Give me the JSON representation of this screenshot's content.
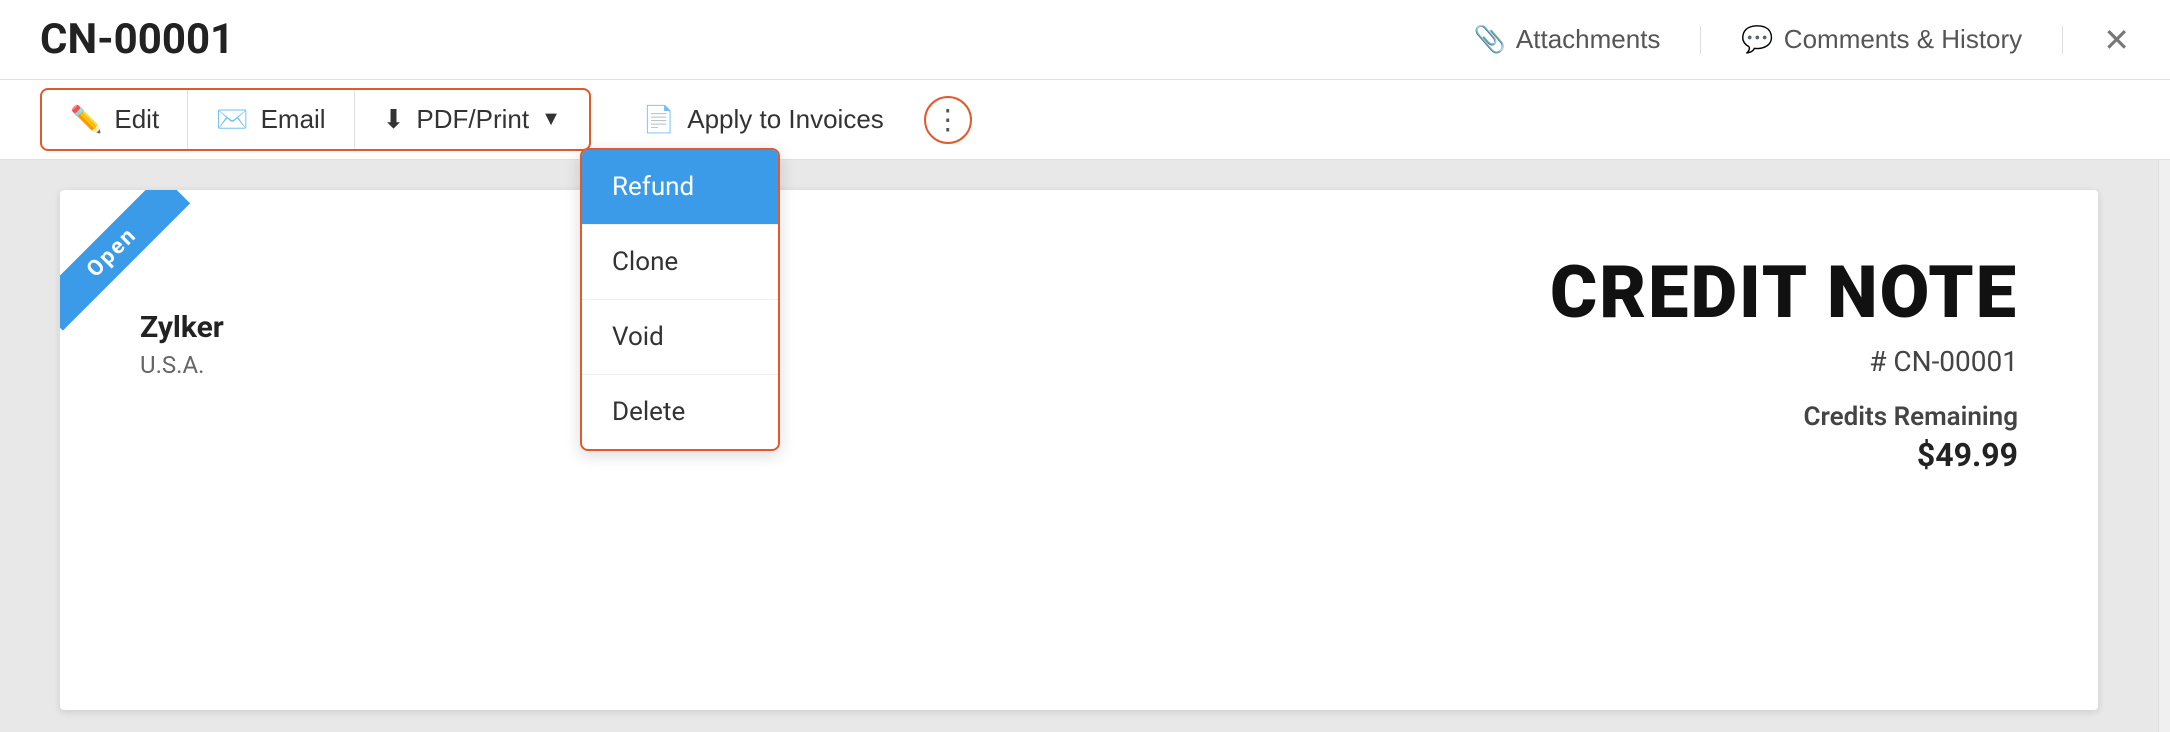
{
  "header": {
    "title": "CN-00001",
    "attachments_label": "Attachments",
    "comments_label": "Comments & History",
    "close_label": "✕"
  },
  "toolbar": {
    "edit_label": "Edit",
    "email_label": "Email",
    "pdf_print_label": "PDF/Print",
    "apply_invoices_label": "Apply to Invoices",
    "more_icon": "⋮"
  },
  "dropdown": {
    "items": [
      {
        "label": "Refund",
        "active": true
      },
      {
        "label": "Clone",
        "active": false
      },
      {
        "label": "Void",
        "active": false
      },
      {
        "label": "Delete",
        "active": false
      }
    ]
  },
  "document": {
    "ribbon_text": "Open",
    "company_name": "Zylker",
    "company_country": "U.S.A.",
    "credit_note_title": "CREDIT NOTE",
    "credit_note_number": "# CN-00001",
    "credits_remaining_label": "Credits Remaining",
    "credits_remaining_value": "$49.99"
  }
}
